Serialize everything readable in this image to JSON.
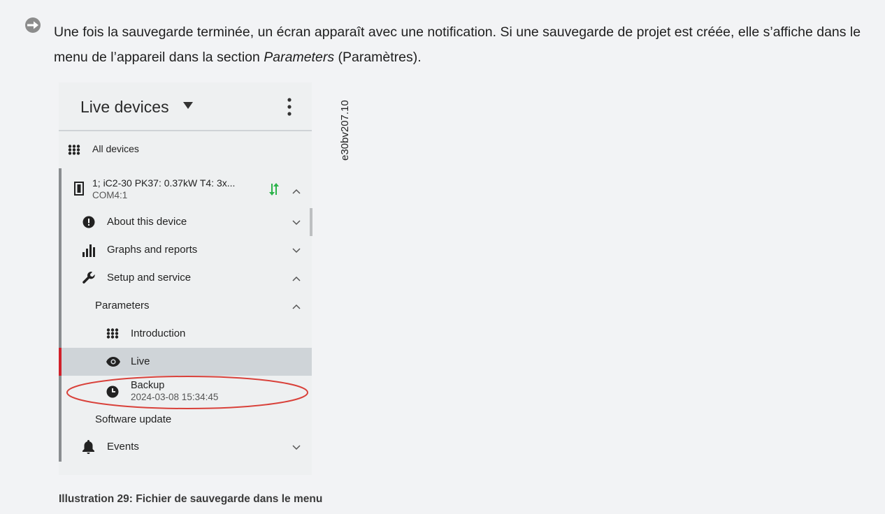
{
  "step": {
    "text_before": "Une fois la sauvegarde terminée, un écran apparaît avec une notification. Si une sauvegarde de projet est créée, elle s’affiche dans le menu de l’appareil dans la section ",
    "text_emphasis": "Parameters",
    "text_after": " (Paramètres).",
    "icon": "arrow-circle-icon"
  },
  "figure_code": "e30bv207.10",
  "app": {
    "title": "Live devices",
    "all_devices": "All devices",
    "device": {
      "name": "1; iC2-30 PK37: 0.37kW T4: 3x...",
      "port": "COM4:1",
      "status_color": "#2bb34a"
    },
    "menu": {
      "about": "About this device",
      "graphs": "Graphs and reports",
      "setup": "Setup and service",
      "parameters": "Parameters",
      "introduction": "Introduction",
      "live": "Live",
      "backup": "Backup",
      "backup_time": "2024-03-08 15:34:45",
      "software_update": "Software update",
      "events": "Events"
    },
    "highlight_color": "#d0202a"
  },
  "caption": "Illustration 29: Fichier de sauvegarde dans le menu"
}
